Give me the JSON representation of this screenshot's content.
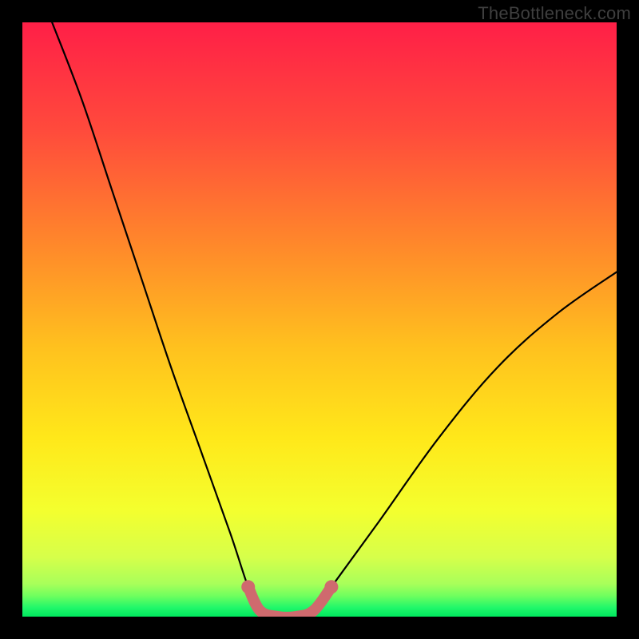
{
  "watermark": {
    "text": "TheBottleneck.com"
  },
  "colors": {
    "bg": "#000000",
    "curve_main": "#000000",
    "highlight": "#cf6a6e",
    "green": "#00e85e"
  },
  "chart_data": {
    "type": "line",
    "title": "",
    "xlabel": "",
    "ylabel": "",
    "xlim": [
      0,
      100
    ],
    "ylim": [
      0,
      100
    ],
    "grid": false,
    "legend": false,
    "note": "Values estimated from pixel positions; x ≈ horizontal %, y ≈ vertical with 0 at bottom.",
    "series": [
      {
        "name": "bottleneck-curve",
        "x": [
          5,
          10,
          15,
          20,
          25,
          30,
          35,
          38,
          40,
          43,
          46,
          49,
          52,
          60,
          70,
          80,
          90,
          100
        ],
        "y": [
          100,
          87,
          72,
          57,
          42,
          28,
          14,
          5,
          1,
          0,
          0,
          1,
          5,
          16,
          30,
          42,
          51,
          58
        ]
      },
      {
        "name": "highlight-segment",
        "x": [
          38,
          40,
          43,
          46,
          49,
          52
        ],
        "y": [
          5,
          1,
          0,
          0,
          1,
          5
        ]
      }
    ],
    "gradient_stops": [
      {
        "offset": 0.0,
        "color": "#ff1f47"
      },
      {
        "offset": 0.18,
        "color": "#ff4a3c"
      },
      {
        "offset": 0.38,
        "color": "#ff8a2a"
      },
      {
        "offset": 0.55,
        "color": "#ffc21e"
      },
      {
        "offset": 0.7,
        "color": "#ffe81a"
      },
      {
        "offset": 0.82,
        "color": "#f4ff2e"
      },
      {
        "offset": 0.9,
        "color": "#d6ff4a"
      },
      {
        "offset": 0.945,
        "color": "#a8ff5a"
      },
      {
        "offset": 0.965,
        "color": "#6fff5e"
      },
      {
        "offset": 0.985,
        "color": "#20f76a"
      },
      {
        "offset": 1.0,
        "color": "#00e85e"
      }
    ]
  }
}
